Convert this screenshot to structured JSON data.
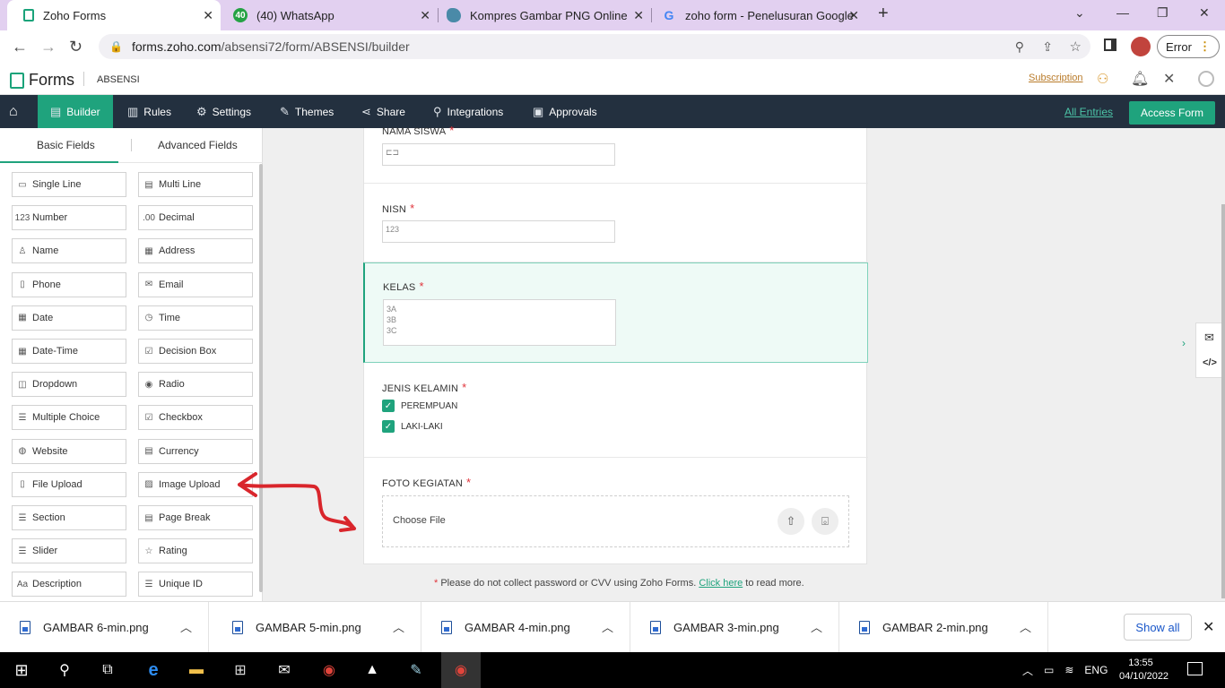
{
  "browser": {
    "tabs": [
      {
        "title": "Zoho Forms",
        "icon": "zoho-forms-icon",
        "active": true
      },
      {
        "title": "(40) WhatsApp",
        "icon": "whatsapp-icon",
        "badge": "40"
      },
      {
        "title": "Kompres Gambar PNG Online",
        "icon": "compress-png-icon"
      },
      {
        "title": "zoho form - Penelusuran Google",
        "icon": "google-icon"
      }
    ],
    "url_host": "forms.zoho.com",
    "url_path": "/absensi72/form/ABSENSI/builder",
    "error_label": "Error"
  },
  "header": {
    "app_name": "Forms",
    "form_name": "ABSENSI",
    "subscription_label": "Subscription"
  },
  "nav": {
    "items": [
      "Builder",
      "Rules",
      "Settings",
      "Themes",
      "Share",
      "Integrations",
      "Approvals"
    ],
    "all_entries": "All Entries",
    "access_form": "Access Form"
  },
  "field_tabs": {
    "basic": "Basic Fields",
    "advanced": "Advanced Fields"
  },
  "basic_fields": [
    [
      "Single Line",
      "Multi Line"
    ],
    [
      "Number",
      "Decimal"
    ],
    [
      "Name",
      "Address"
    ],
    [
      "Phone",
      "Email"
    ],
    [
      "Date",
      "Time"
    ],
    [
      "Date-Time",
      "Decision Box"
    ],
    [
      "Dropdown",
      "Radio"
    ],
    [
      "Multiple Choice",
      "Checkbox"
    ],
    [
      "Website",
      "Currency"
    ],
    [
      "File Upload",
      "Image Upload"
    ],
    [
      "Section",
      "Page Break"
    ],
    [
      "Slider",
      "Rating"
    ],
    [
      "Description",
      "Unique ID"
    ]
  ],
  "form": {
    "nama_siswa": {
      "label": "NAMA SISWA",
      "input_icon": "⊏⊐"
    },
    "nisn": {
      "label": "NISN",
      "placeholder": "123"
    },
    "kelas": {
      "label": "KELAS",
      "options": [
        "3A",
        "3B",
        "3C"
      ]
    },
    "jenis_kelamin": {
      "label": "JENIS KELAMIN",
      "options": [
        "PEREMPUAN",
        "LAKI-LAKI"
      ]
    },
    "foto": {
      "label": "FOTO KEGIATAN",
      "choose_file": "Choose File"
    },
    "required_mark": "*"
  },
  "warning": {
    "text_before": "Please do not collect password or CVV using Zoho Forms.",
    "link": "Click here",
    "text_after": "to read more."
  },
  "downloads": {
    "files": [
      "GAMBAR 6-min.png",
      "GAMBAR 5-min.png",
      "GAMBAR 4-min.png",
      "GAMBAR 3-min.png",
      "GAMBAR 2-min.png"
    ],
    "show_all": "Show all"
  },
  "taskbar": {
    "language": "ENG",
    "time": "13:55",
    "date": "04/10/2022"
  },
  "colors": {
    "accent": "#1fa37d",
    "navbar": "#23303f",
    "required": "#e0343b",
    "annotation_arrow": "#d9262c"
  }
}
